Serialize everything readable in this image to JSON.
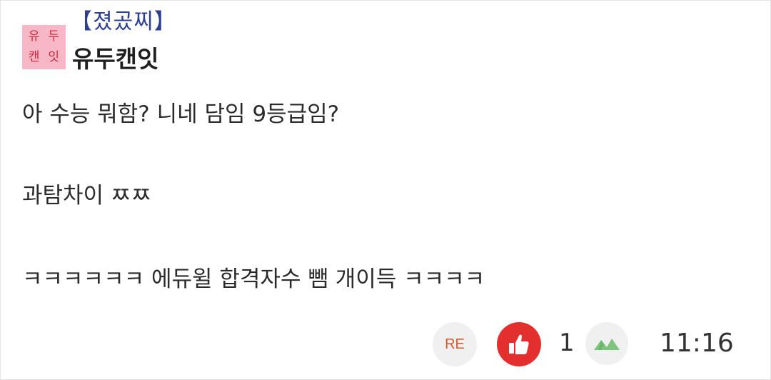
{
  "post": {
    "avatar_chars": [
      "유",
      "두",
      "캔",
      "잇"
    ],
    "tag": "【졌곴찌】",
    "username": "유두캔잇",
    "lines": [
      "아 수능 뭐함? 니네 담임 9등급임?",
      "과탐차이 ㅉㅉ",
      "ㅋㅋㅋㅋㅋㅋ 에듀윌 합격자수 뺌 개이득 ㅋㅋㅋㅋ"
    ]
  },
  "footer": {
    "reply_label": "RE",
    "like_icon": "thumbs-up-icon",
    "like_count": "1",
    "mountain_icon": "mountain-icon",
    "time": "11:16"
  },
  "colors": {
    "avatar_bg": "#f7b7c6",
    "avatar_text": "#d0273c",
    "tag": "#2d3f93",
    "like_bg": "#e42f2f",
    "reply_text": "#d9582b",
    "mountain": "#7fc47f"
  }
}
